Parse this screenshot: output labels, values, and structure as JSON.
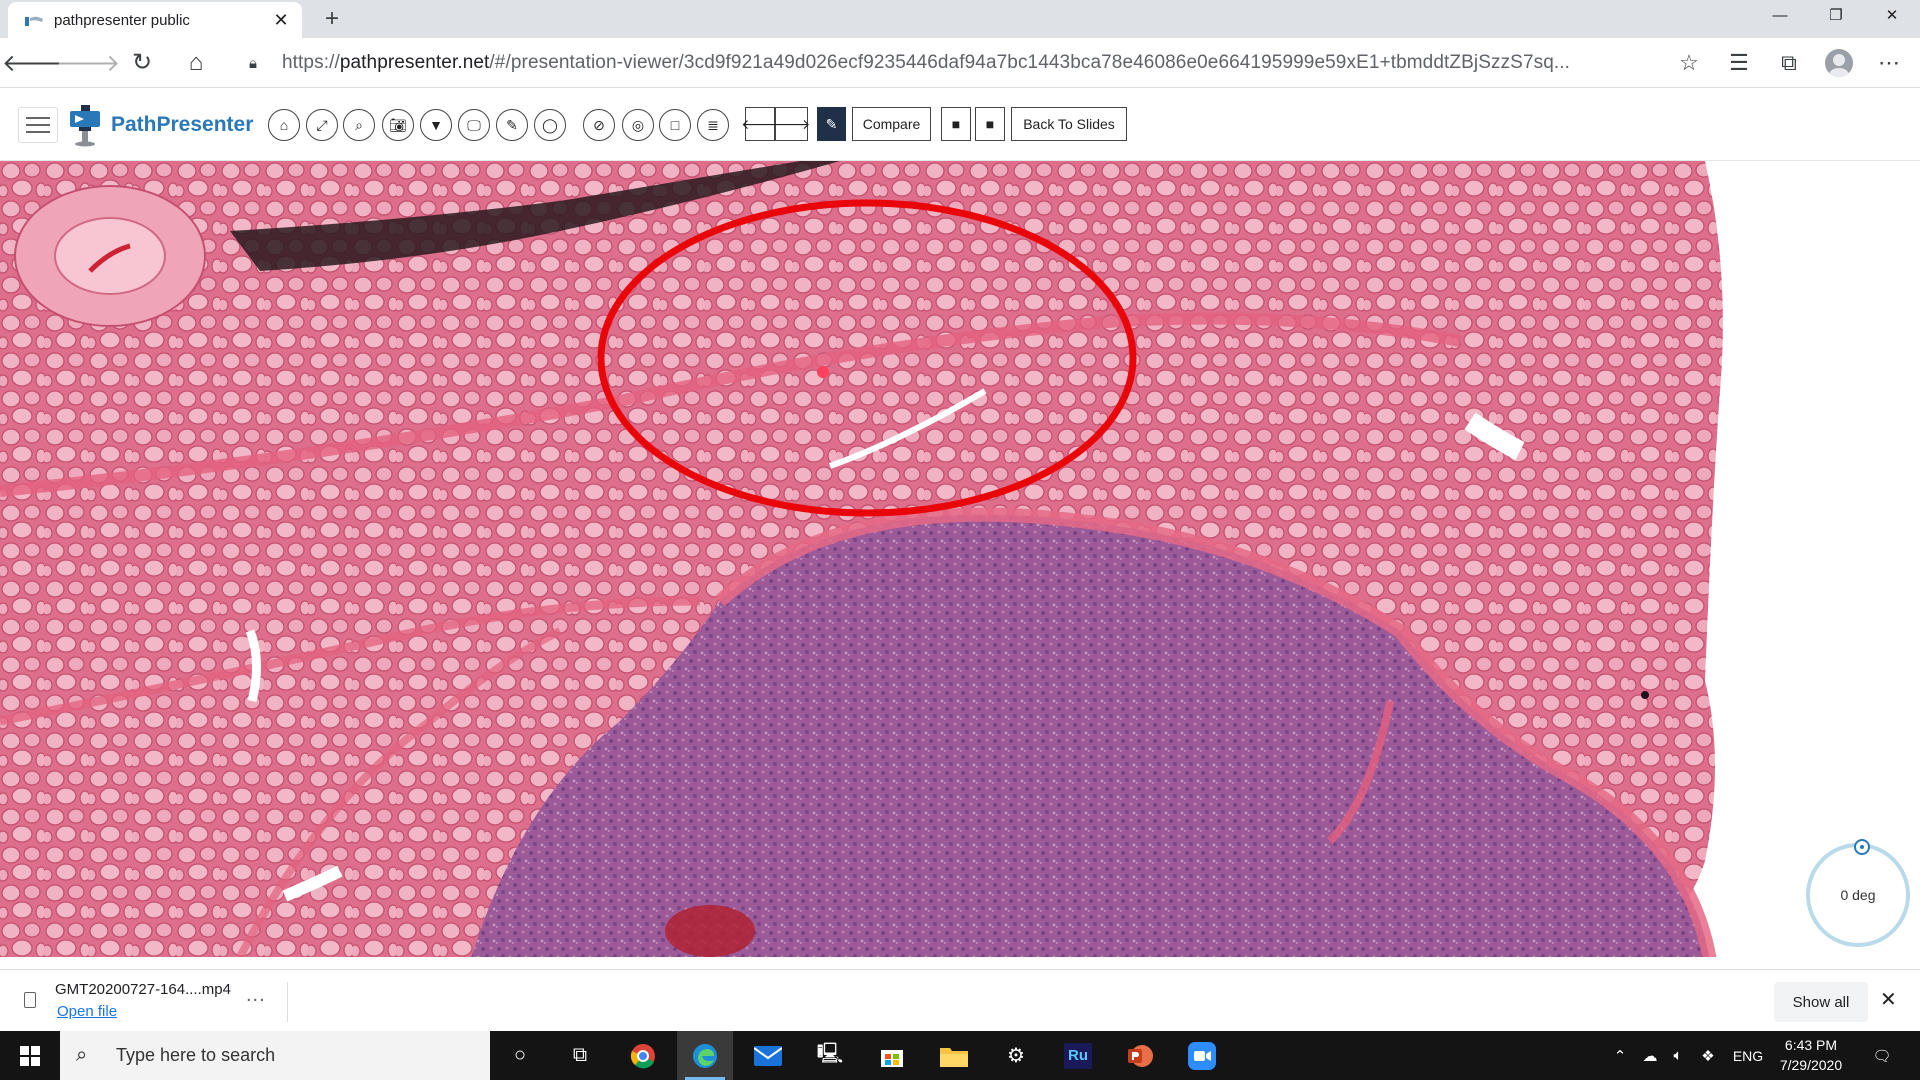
{
  "browser": {
    "tab_title": "pathpresenter public",
    "new_tab_symbol": "+",
    "url_scheme": "https://",
    "url_host": "pathpresenter.net",
    "url_path": "/#/presentation-viewer/3cd9f921a49d026ecf9235446daf94a7bc1443bca78e46086e0e664195999e59xE1+tbmddtZBjSzzS7sq..."
  },
  "app": {
    "brand": "PathPresenter",
    "compare_label": "Compare",
    "back_label": "Back To Slides",
    "brand_color": "#2a78b8",
    "annotation_color": "#e8060a"
  },
  "viewer": {
    "rotation_label": "0 deg"
  },
  "download": {
    "filename": "GMT20200727-164....mp4",
    "open_label": "Open file",
    "more_symbol": "...",
    "show_all_label": "Show all"
  },
  "taskbar": {
    "search_placeholder": "Type here to search",
    "lang": "ENG",
    "time": "6:43 PM",
    "date": "7/29/2020",
    "ru_label": "Ru"
  }
}
